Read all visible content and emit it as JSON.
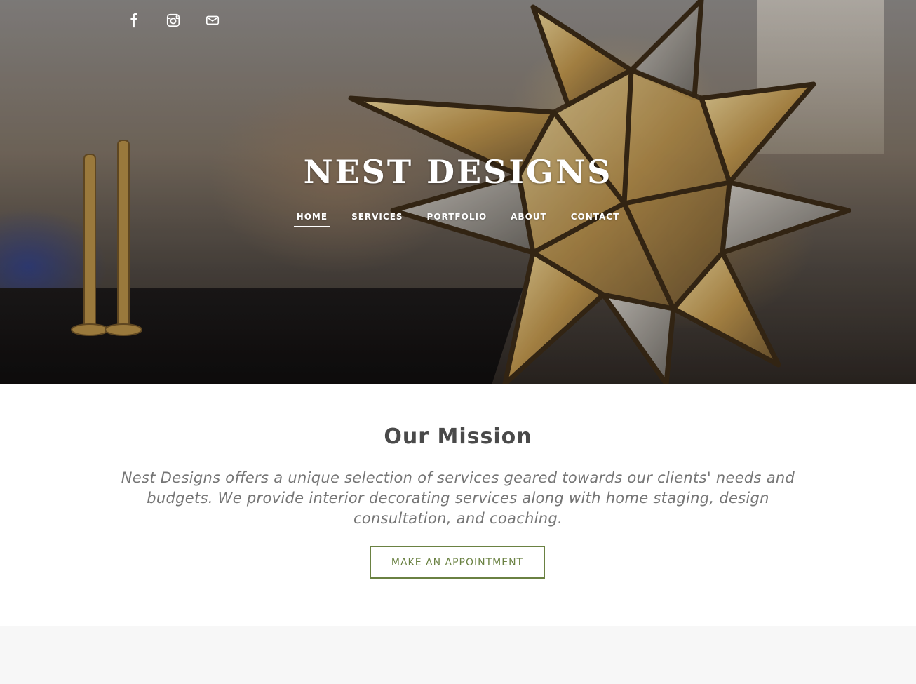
{
  "social": [
    {
      "name": "facebook",
      "icon": "facebook-icon"
    },
    {
      "name": "instagram",
      "icon": "instagram-icon"
    },
    {
      "name": "email",
      "icon": "mail-icon"
    }
  ],
  "site": {
    "title": "NEST DESIGNS"
  },
  "nav": {
    "items": [
      {
        "label": "HOME",
        "active": true
      },
      {
        "label": "SERVICES",
        "active": false
      },
      {
        "label": "PORTFOLIO",
        "active": false
      },
      {
        "label": "ABOUT",
        "active": false
      },
      {
        "label": "CONTACT",
        "active": false
      }
    ]
  },
  "mission": {
    "title": "Our Mission",
    "text": "Nest Designs offers a unique selection of services geared towards our clients' needs and budgets. We provide interior decorating services along with home staging, design consultation, and coaching.",
    "cta_label": "MAKE AN APPOINTMENT"
  },
  "colors": {
    "accent": "#6a8142",
    "heading": "#4a4a4a",
    "body_text": "#757575",
    "footer_bg": "#f7f7f7"
  }
}
